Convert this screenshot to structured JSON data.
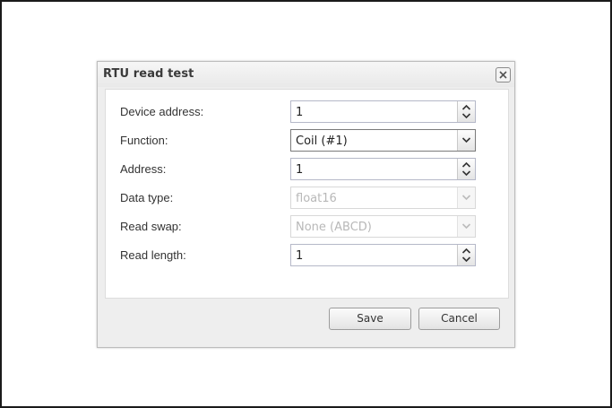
{
  "dialog": {
    "title": "RTU read test",
    "close_icon": "close-icon"
  },
  "form": {
    "fields": [
      {
        "label": "Device address:",
        "value": "1",
        "control": "spinner",
        "enabled": true
      },
      {
        "label": "Function:",
        "value": "Coil (#1)",
        "control": "combobox",
        "enabled": true
      },
      {
        "label": "Address:",
        "value": "1",
        "control": "spinner",
        "enabled": true
      },
      {
        "label": "Data type:",
        "value": "float16",
        "control": "combobox",
        "enabled": false
      },
      {
        "label": "Read swap:",
        "value": "None (ABCD)",
        "control": "combobox",
        "enabled": false
      },
      {
        "label": "Read length:",
        "value": "1",
        "control": "spinner",
        "enabled": true
      }
    ]
  },
  "footer": {
    "save_label": "Save",
    "cancel_label": "Cancel"
  },
  "colors": {
    "field_border": "#b5b8c8",
    "disabled_text": "#b8b8b8",
    "dialog_background": "#eeeeee"
  }
}
